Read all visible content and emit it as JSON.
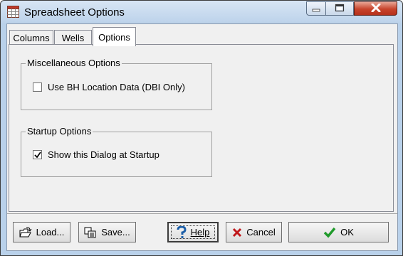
{
  "window": {
    "title": "Spreadsheet Options"
  },
  "tabs": [
    {
      "label": "Columns"
    },
    {
      "label": "Wells"
    },
    {
      "label": "Options",
      "active": true
    }
  ],
  "misc_group": {
    "title": "Miscellaneous Options",
    "checkbox": {
      "label": "Use BH Location Data (DBI Only)",
      "checked": false
    }
  },
  "startup_group": {
    "title": "Startup Options",
    "checkbox": {
      "label": "Show this Dialog at Startup",
      "checked": true
    }
  },
  "buttons": {
    "load": "Load...",
    "save": "Save...",
    "help": "Help",
    "cancel": "Cancel",
    "ok": "OK"
  },
  "icons": {
    "app": "spreadsheet-icon",
    "load": "open-folder-icon",
    "save": "save-icon",
    "help": "question-mark-icon",
    "cancel": "red-x-icon",
    "ok": "green-check-icon"
  },
  "colors": {
    "close_button": "#c7432b",
    "cancel_icon": "#c0181b",
    "ok_icon": "#1f9a2a",
    "help_icon": "#1d5fa8"
  }
}
